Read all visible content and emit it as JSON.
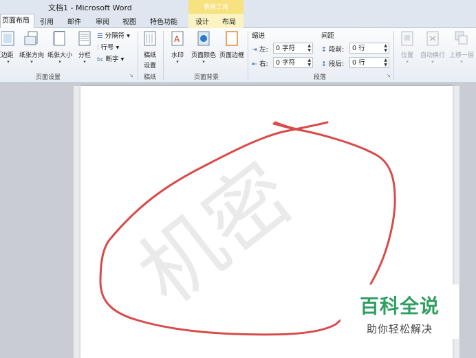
{
  "window": {
    "title": "文档1 - Microsoft Word",
    "context_tool": "表格工具"
  },
  "tabs": [
    {
      "label": "页面布局",
      "active": true
    },
    {
      "label": "引用"
    },
    {
      "label": "邮件"
    },
    {
      "label": "审阅"
    },
    {
      "label": "视图"
    },
    {
      "label": "特色功能"
    },
    {
      "label": "设计"
    },
    {
      "label": "布局"
    }
  ],
  "ribbon": {
    "page_setup": {
      "label": "页面设置",
      "buttons": [
        "页边距",
        "纸张方向",
        "纸张大小",
        "分栏"
      ],
      "small": [
        "分隔符",
        "行号",
        "断字"
      ]
    },
    "manuscript": {
      "label": "稿纸",
      "button_line1": "稿纸",
      "button_line2": "设置"
    },
    "page_background": {
      "label": "页面背景",
      "buttons": [
        "水印",
        "页面颜色",
        "页面边框"
      ]
    },
    "paragraph": {
      "label": "段落",
      "indent_header": "缩进",
      "spacing_header": "间距",
      "left_label": "左:",
      "right_label": "右:",
      "before_label": "段前:",
      "after_label": "段后:",
      "left_value": "0 字符",
      "right_value": "0 字符",
      "before_value": "0 行",
      "after_value": "0 行"
    },
    "arrange": {
      "buttons": [
        "位置",
        "自动换行",
        "上移一层"
      ]
    }
  },
  "document": {
    "watermark_big": "机密",
    "brand_title": "百科全说",
    "brand_sub": "助你轻松解决",
    "annotation_color": "#d94a4a"
  }
}
